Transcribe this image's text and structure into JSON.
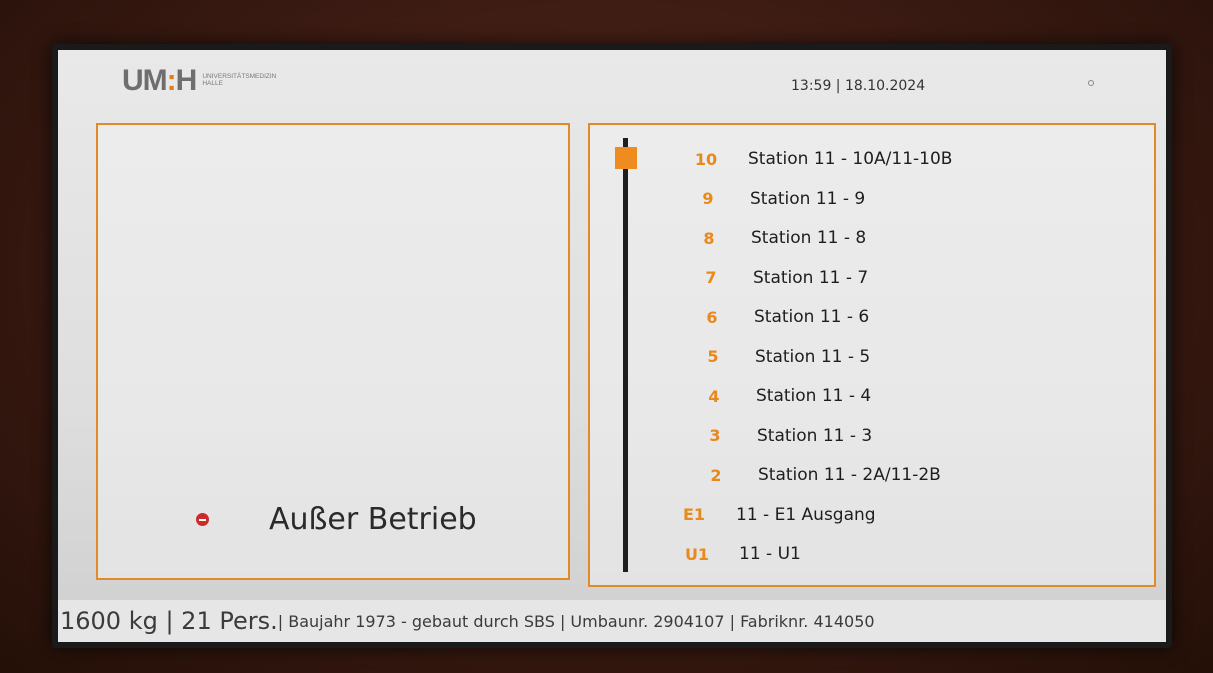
{
  "header": {
    "logo_mark_left": "UM",
    "logo_mark_sep": ":",
    "logo_mark_right": "H",
    "logo_line1": "Universitätsmedizin",
    "logo_line2": "Halle",
    "datetime": "13:59 | 18.10.2024"
  },
  "status": {
    "icon": "no-entry-icon",
    "text": "Außer Betrieb",
    "color": "#cc2b2b"
  },
  "elevator": {
    "current_floor": "10",
    "accent_color": "#e8891c",
    "floors": [
      {
        "num": "10",
        "label": "Station 11 - 10A/11-10B"
      },
      {
        "num": "9",
        "label": "Station 11 - 9"
      },
      {
        "num": "8",
        "label": "Station 11 - 8"
      },
      {
        "num": "7",
        "label": "Station 11 - 7"
      },
      {
        "num": "6",
        "label": "Station 11 - 6"
      },
      {
        "num": "5",
        "label": "Station 11 - 5"
      },
      {
        "num": "4",
        "label": "Station 11 - 4"
      },
      {
        "num": "3",
        "label": "Station 11 - 3"
      },
      {
        "num": "2",
        "label": "Station 11 - 2A/11-2B"
      },
      {
        "num": "E1",
        "label": "11 - E1 Ausgang"
      },
      {
        "num": "U1",
        "label": "11 - U1"
      }
    ]
  },
  "footer": {
    "capacity": "1600 kg | 21 Pers.",
    "details": "| Baujahr 1973  - gebaut durch SBS  | Umbaunr. 2904107 | Fabriknr. 414050"
  }
}
